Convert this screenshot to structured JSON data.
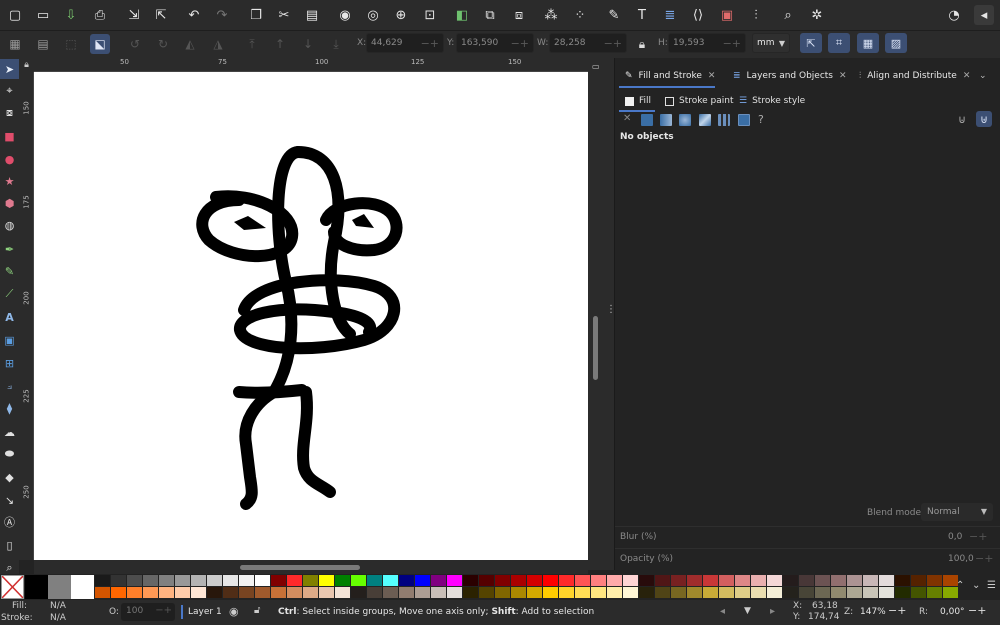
{
  "control_bar": {
    "x_label": "X:",
    "x_value": "44,629",
    "y_label": "Y:",
    "y_value": "163,590",
    "w_label": "W:",
    "w_value": "28,258",
    "h_label": "H:",
    "h_value": "19,593",
    "unit": "mm"
  },
  "ruler": {
    "top_ticks": [
      "50",
      "75",
      "100",
      "125",
      "150"
    ],
    "left_ticks": [
      "150",
      "175",
      "200",
      "225",
      "250"
    ]
  },
  "panel": {
    "tabs": [
      {
        "label": "Fill and Stroke"
      },
      {
        "label": "Layers and Objects"
      },
      {
        "label": "Align and Distribute"
      }
    ],
    "subtabs": [
      {
        "label": "Fill"
      },
      {
        "label": "Stroke paint"
      },
      {
        "label": "Stroke style"
      }
    ],
    "unknown_paint": "?",
    "no_objects": "No objects",
    "blend_label": "Blend mode:",
    "blend_value": "Normal",
    "blur_label": "Blur (%)",
    "blur_value": "0,0",
    "opacity_label": "Opacity (%)",
    "opacity_value": "100,0"
  },
  "status": {
    "fill_label": "Fill:",
    "fill_value": "N/A",
    "stroke_label": "Stroke:",
    "stroke_value": "N/A",
    "opacity_label": "O:",
    "opacity_value": "100",
    "layer": "Layer 1",
    "hint_key1": "Ctrl",
    "hint_text1": ": Select inside groups, Move one axis only; ",
    "hint_key2": "Shift",
    "hint_text2": ": Add to selection",
    "x_label": "X:",
    "x_value": "63,18",
    "y_label": "Y:",
    "y_value": "174,74",
    "zoom_label": "Z:",
    "zoom_value": "147%",
    "rotate_label": "R:",
    "rotate_value": "0,00°"
  },
  "palette_row1": [
    "#1a1a1a",
    "#333333",
    "#4d4d4d",
    "#666666",
    "#808080",
    "#999999",
    "#b3b3b3",
    "#cccccc",
    "#e6e6e6",
    "#f2f2f2",
    "#ffffff",
    "#800000",
    "#ff2a2a",
    "#808000",
    "#ffff00",
    "#008000",
    "#66ff00",
    "#008080",
    "#55ffff",
    "#000080",
    "#0000ff",
    "#800080",
    "#ff00ff",
    "#2b0000",
    "#550000",
    "#800000",
    "#aa0000",
    "#d40000",
    "#ff0000",
    "#ff2a2a",
    "#ff5555",
    "#ff8080",
    "#ffaaaa",
    "#ffd5d5",
    "#280b0b",
    "#501616",
    "#782121",
    "#a02c2c",
    "#c83737",
    "#d35f5f",
    "#de8787",
    "#e9afaf",
    "#f4d7d7",
    "#241c1c",
    "#483737",
    "#6c5353",
    "#916f6f",
    "#ac9393",
    "#c8b7b7",
    "#e3dbdb",
    "#2b1100",
    "#552200",
    "#803300",
    "#aa4400"
  ],
  "palette_row2": [
    "#d45500",
    "#ff6600",
    "#ff7f2a",
    "#ff9955",
    "#ffb380",
    "#ffccaa",
    "#ffe6d5",
    "#28170b",
    "#502d16",
    "#784421",
    "#a05a2c",
    "#c87137",
    "#d38d5f",
    "#deaa87",
    "#e9c6af",
    "#f4e3d7",
    "#241f1c",
    "#483e37",
    "#6c5d53",
    "#917c6f",
    "#ac9d93",
    "#c8beb7",
    "#e3dedb",
    "#2b2200",
    "#554400",
    "#806600",
    "#aa8800",
    "#d4aa00",
    "#ffcc00",
    "#ffd42a",
    "#ffdd55",
    "#ffe680",
    "#ffeeaa",
    "#fff6d5",
    "#28220b",
    "#504416",
    "#786721",
    "#a0892c",
    "#c8ab37",
    "#d3bc5f",
    "#decd87",
    "#e9ddaf",
    "#f4eed7",
    "#24221c",
    "#484537",
    "#6c6753",
    "#918a6f",
    "#aca793",
    "#c8c4b7",
    "#e3e2db",
    "#222b00",
    "#445500",
    "#668000",
    "#88aa00"
  ]
}
